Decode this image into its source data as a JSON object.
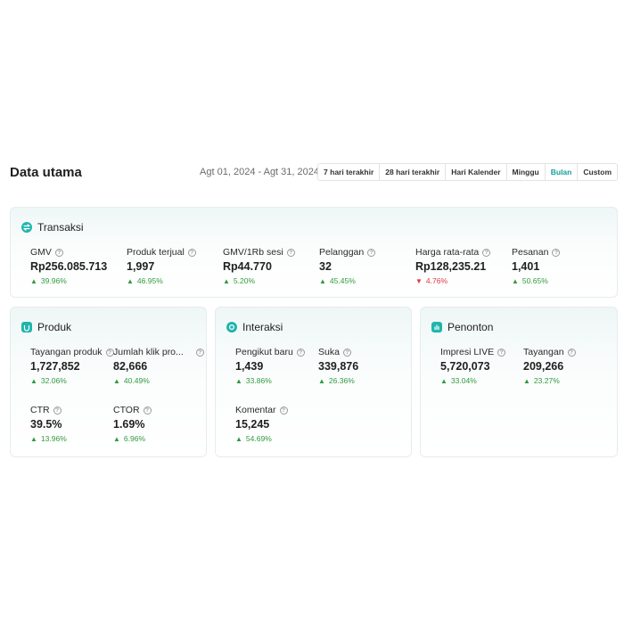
{
  "header": {
    "title": "Data utama",
    "date_range": "Agt 01, 2024 - Agt 31, 2024",
    "periods": [
      "7 hari terakhir",
      "28 hari terakhir",
      "Hari Kalender",
      "Minggu",
      "Bulan",
      "Custom"
    ],
    "active_period": "Bulan"
  },
  "transaksi": {
    "title": "Transaksi",
    "metrics": [
      {
        "label": "GMV",
        "value": "Rp256.085.713",
        "change": "39.96%",
        "direction": "up"
      },
      {
        "label": "Produk terjual",
        "value": "1,997",
        "change": "46.95%",
        "direction": "up"
      },
      {
        "label": "GMV/1Rb sesi",
        "value": "Rp44.770",
        "change": "5.20%",
        "direction": "up"
      },
      {
        "label": "Pelanggan",
        "value": "32",
        "change": "45.45%",
        "direction": "up"
      },
      {
        "label": "Harga rata-rata",
        "value": "Rp128,235.21",
        "change": "4.76%",
        "direction": "down"
      },
      {
        "label": "Pesanan",
        "value": "1,401",
        "change": "50.65%",
        "direction": "up"
      }
    ]
  },
  "produk": {
    "title": "Produk",
    "metrics": [
      {
        "label": "Tayangan produk",
        "value": "1,727,852",
        "change": "32.06%",
        "direction": "up"
      },
      {
        "label": "Jumlah klik pro...",
        "value": "82,666",
        "change": "40.49%",
        "direction": "up"
      },
      {
        "label": "CTR",
        "value": "39.5%",
        "change": "13.96%",
        "direction": "up"
      },
      {
        "label": "CTOR",
        "value": "1.69%",
        "change": "6.96%",
        "direction": "up"
      }
    ]
  },
  "interaksi": {
    "title": "Interaksi",
    "metrics": [
      {
        "label": "Pengikut baru",
        "value": "1,439",
        "change": "33.86%",
        "direction": "up"
      },
      {
        "label": "Suka",
        "value": "339,876",
        "change": "26.36%",
        "direction": "up"
      },
      {
        "label": "Komentar",
        "value": "15,245",
        "change": "54.69%",
        "direction": "up"
      }
    ]
  },
  "penonton": {
    "title": "Penonton",
    "metrics": [
      {
        "label": "Impresi LIVE",
        "value": "5,720,073",
        "change": "33.04%",
        "direction": "up"
      },
      {
        "label": "Tayangan",
        "value": "209,266",
        "change": "23.27%",
        "direction": "up"
      }
    ]
  },
  "icons": {
    "up": "▲",
    "down": "▼",
    "info": "?"
  },
  "colors": {
    "accent": "#1fb5ad",
    "up": "#2f9a3f",
    "down": "#e0393e",
    "active_tab": "#139e9a"
  }
}
